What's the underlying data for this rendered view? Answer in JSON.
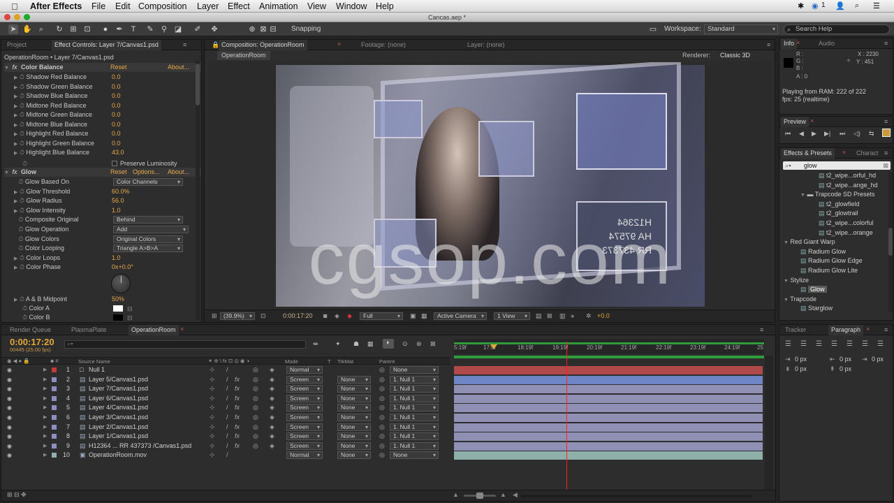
{
  "app": {
    "name": "After Effects",
    "menu": [
      "File",
      "Edit",
      "Composition",
      "Layer",
      "Effect",
      "Animation",
      "View",
      "Window",
      "Help"
    ],
    "doc_title": "Cancas.aep *",
    "status_icons": [
      "bluetooth-icon",
      "sync-icon",
      "user-icon",
      "search-icon",
      "list-icon"
    ],
    "status_badge": "1"
  },
  "toolbar": {
    "snapping": "Snapping",
    "workspace_label": "Workspace:",
    "workspace_value": "Standard",
    "search_help": "Search Help"
  },
  "project_panel": {
    "tabs": [
      "Project",
      "Effect Controls: Layer 7/Canvas1.psd"
    ],
    "breadcrumb": "OperationRoom • Layer 7/Canvas1.psd",
    "color_balance": {
      "name": "Color Balance",
      "reset": "Reset",
      "about": "About...",
      "params": [
        {
          "label": "Shadow Red Balance",
          "value": "0.0"
        },
        {
          "label": "Shadow Green Balance",
          "value": "0.0"
        },
        {
          "label": "Shadow Blue Balance",
          "value": "0.0"
        },
        {
          "label": "Midtone Red Balance",
          "value": "0.0"
        },
        {
          "label": "Midtone Green Balance",
          "value": "0.0"
        },
        {
          "label": "Midtone Blue Balance",
          "value": "0.0"
        },
        {
          "label": "Highlight Red Balance",
          "value": "0.0"
        },
        {
          "label": "Highlight Green Balance",
          "value": "0.0"
        },
        {
          "label": "Highlight Blue Balance",
          "value": "43.0"
        }
      ],
      "preserve": "Preserve Luminosity"
    },
    "glow": {
      "name": "Glow",
      "reset": "Reset",
      "options": "Options...",
      "about": "About...",
      "params": [
        {
          "label": "Glow Based On",
          "value": "Color Channels",
          "kind": "select"
        },
        {
          "label": "Glow Threshold",
          "value": "60.0%",
          "kind": "value"
        },
        {
          "label": "Glow Radius",
          "value": "56.0",
          "kind": "value"
        },
        {
          "label": "Glow Intensity",
          "value": "1.0",
          "kind": "value"
        },
        {
          "label": "Composite Original",
          "value": "Behind",
          "kind": "select"
        },
        {
          "label": "Glow Operation",
          "value": "Add",
          "kind": "select"
        },
        {
          "label": "Glow Colors",
          "value": "Original Colors",
          "kind": "select"
        },
        {
          "label": "Color Looping",
          "value": "Triangle A>B>A",
          "kind": "select"
        },
        {
          "label": "Color Loops",
          "value": "1.0",
          "kind": "value"
        },
        {
          "label": "Color Phase",
          "value": "0x+0.0°",
          "kind": "value"
        }
      ],
      "midpoint_label": "A & B Midpoint",
      "midpoint_value": "50%",
      "color_a": "Color A",
      "color_b": "Color B"
    }
  },
  "composition": {
    "tabs": [
      "Composition: OperationRoom",
      "Footage: (none)",
      "Layer: (none)"
    ],
    "sub_tab": "OperationRoom",
    "renderer_label": "Renderer:",
    "renderer_value": "Classic 3D",
    "watermark": "cgsop.com",
    "plate_text": [
      "H12364",
      "HA 97574",
      "RR 437373"
    ],
    "footer": {
      "zoom": "(39.9%)",
      "timecode": "0:00:17:20",
      "resolution": "Full",
      "camera": "Active Camera",
      "view": "1 View",
      "exposure": "+0.0"
    }
  },
  "info_panel": {
    "tabs": [
      "Info",
      "Audio"
    ],
    "r": "R :",
    "g": "G :",
    "b": "B :",
    "a": "A : 0",
    "x": "X : 2230",
    "y": "Y : 451",
    "playing": "Playing from RAM: 222 of 222",
    "fps": "fps: 25 (realtime)"
  },
  "preview_panel": {
    "tab": "Preview"
  },
  "effects_panel": {
    "tabs": [
      "Effects & Presets",
      "Charact"
    ],
    "search": "glow",
    "items": [
      {
        "label": "t2_wipe...orful_hd",
        "level": 2,
        "kind": "preset"
      },
      {
        "label": "t2_wipe...ange_hd",
        "level": 2,
        "kind": "preset"
      },
      {
        "label": "Trapcode SD Presets",
        "level": 1,
        "kind": "folder"
      },
      {
        "label": "t2_glowfield",
        "level": 2,
        "kind": "preset"
      },
      {
        "label": "t2_glowtrail",
        "level": 2,
        "kind": "preset"
      },
      {
        "label": "t2_wipe...colorful",
        "level": 2,
        "kind": "preset"
      },
      {
        "label": "t2_wipe...orange",
        "level": 2,
        "kind": "preset"
      },
      {
        "label": "Red Giant Warp",
        "level": 0,
        "kind": "category"
      },
      {
        "label": "Radium Glow",
        "level": 1,
        "kind": "effect"
      },
      {
        "label": "Radium Glow Edge",
        "level": 1,
        "kind": "effect"
      },
      {
        "label": "Radium Glow Lite",
        "level": 1,
        "kind": "effect"
      },
      {
        "label": "Stylize",
        "level": 0,
        "kind": "category"
      },
      {
        "label": "Glow",
        "level": 1,
        "kind": "effect",
        "selected": true
      },
      {
        "label": "Trapcode",
        "level": 0,
        "kind": "category"
      },
      {
        "label": "Starglow",
        "level": 1,
        "kind": "effect"
      }
    ]
  },
  "paragraph_panel": {
    "tabs": [
      "Tracker",
      "Paragraph"
    ],
    "fields": [
      "0 px",
      "0 px",
      "0 px",
      "0 px",
      "0 px"
    ]
  },
  "timeline": {
    "tabs": [
      "Render Queue",
      "PlasmaPlate",
      "OperationRoom"
    ],
    "timecode": "0:00:17:20",
    "frames": "00445 (25.00 fps)",
    "columns": {
      "source": "Source Name",
      "mode": "Mode",
      "t": "T",
      "trkmat": "TrkMat",
      "parent": "Parent"
    },
    "ruler": [
      "5:19f",
      "17:0f",
      "18:19f",
      "19:19f",
      "20:19f",
      "21:19f",
      "22:19f",
      "23:19f",
      "24:19f",
      "25"
    ],
    "playhead_fraction": 0.363,
    "layers": [
      {
        "num": "1",
        "name": "Null 1",
        "color": "#c23a3a",
        "mode": "Normal",
        "trkmat": "",
        "parent": "None",
        "bar": "#b04a4a",
        "icon": "null"
      },
      {
        "num": "2",
        "name": "Layer 5/Canvas1.psd",
        "color": "#8d8fc2",
        "mode": "Screen",
        "trkmat": "None",
        "parent": "1. Null 1",
        "bar": "#6f86c4",
        "icon": "psd"
      },
      {
        "num": "3",
        "name": "Layer 7/Canvas1.psd",
        "color": "#8d8fc2",
        "mode": "Screen",
        "trkmat": "None",
        "parent": "1. Null 1",
        "bar": "#8f90b4",
        "icon": "psd"
      },
      {
        "num": "4",
        "name": "Layer 6/Canvas1.psd",
        "color": "#8d8fc2",
        "mode": "Screen",
        "trkmat": "None",
        "parent": "1. Null 1",
        "bar": "#8f90b4",
        "icon": "psd"
      },
      {
        "num": "5",
        "name": "Layer 4/Canvas1.psd",
        "color": "#8d8fc2",
        "mode": "Screen",
        "trkmat": "None",
        "parent": "1. Null 1",
        "bar": "#8f90b4",
        "icon": "psd"
      },
      {
        "num": "6",
        "name": "Layer 3/Canvas1.psd",
        "color": "#8d8fc2",
        "mode": "Screen",
        "trkmat": "None",
        "parent": "1. Null 1",
        "bar": "#8f90b4",
        "icon": "psd"
      },
      {
        "num": "7",
        "name": "Layer 2/Canvas1.psd",
        "color": "#8d8fc2",
        "mode": "Screen",
        "trkmat": "None",
        "parent": "1. Null 1",
        "bar": "#8f90b4",
        "icon": "psd"
      },
      {
        "num": "8",
        "name": "Layer 1/Canvas1.psd",
        "color": "#8d8fc2",
        "mode": "Screen",
        "trkmat": "None",
        "parent": "1. Null 1",
        "bar": "#8f90b4",
        "icon": "psd"
      },
      {
        "num": "9",
        "name": "H12364 ... RR 437373 /Canvas1.psd",
        "color": "#8d8fc2",
        "mode": "Screen",
        "trkmat": "None",
        "parent": "1. Null 1",
        "bar": "#8f90b4",
        "icon": "psd"
      },
      {
        "num": "10",
        "name": "OperationRoom.mov",
        "color": "#8fb0b0",
        "mode": "Normal",
        "trkmat": "None",
        "parent": "None",
        "bar": "#8fb0a8",
        "icon": "mov"
      }
    ]
  },
  "colors": {
    "accent": "#e8a94a",
    "timecode": "#e3a83a",
    "playhead": "#ff2020",
    "work_area": "#2f9d3c"
  }
}
